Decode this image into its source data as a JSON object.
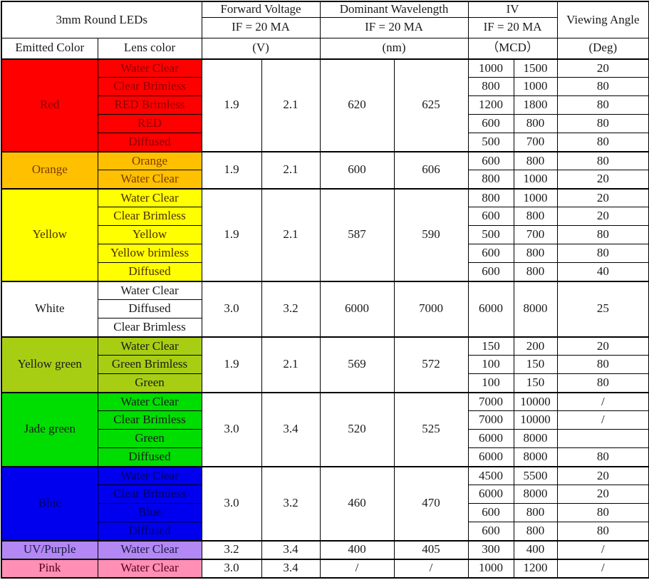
{
  "header": {
    "title": "3mm Round LEDs",
    "columns": [
      {
        "name": "Forward Voltage",
        "condition": "IF = 20 MA",
        "unit": "(V)"
      },
      {
        "name": "Dominant Wavelength",
        "condition": "IF = 20 MA",
        "unit": "(nm)"
      },
      {
        "name": "IV",
        "condition": "IF = 20 MA",
        "unit": "（MCD）"
      },
      {
        "name": "Viewing Angle",
        "condition": "",
        "unit": "(Deg)"
      }
    ],
    "emitted_color_label": "Emitted Color",
    "lens_color_label": "Lens color"
  },
  "groups": [
    {
      "emitted_color": "Red",
      "bg": "#FF0000",
      "text_color": "#8B0000",
      "lens_bg": "#FF0000",
      "lens_text": "#8B0000",
      "vf_min": "1.9",
      "vf_max": "2.1",
      "wl_min": "620",
      "wl_max": "625",
      "rows": [
        {
          "lens": "Water Clear",
          "iv_min": "1000",
          "iv_max": "1500",
          "angle": "20"
        },
        {
          "lens": "Clear Brimless",
          "iv_min": "800",
          "iv_max": "1000",
          "angle": "80"
        },
        {
          "lens": "RED Brimless",
          "iv_min": "1200",
          "iv_max": "1800",
          "angle": "80"
        },
        {
          "lens": "RED",
          "iv_min": "600",
          "iv_max": "800",
          "angle": "80"
        },
        {
          "lens": "Diffused",
          "iv_min": "500",
          "iv_max": "700",
          "angle": "80"
        }
      ]
    },
    {
      "emitted_color": "Orange",
      "bg": "#FFC000",
      "text_color": "#7A3B00",
      "lens_bg": "#FFC000",
      "lens_text": "#7A3B00",
      "vf_min": "1.9",
      "vf_max": "2.1",
      "wl_min": "600",
      "wl_max": "606",
      "rows": [
        {
          "lens": "Orange",
          "iv_min": "600",
          "iv_max": "800",
          "angle": "80"
        },
        {
          "lens": "Water Clear",
          "iv_min": "800",
          "iv_max": "1000",
          "angle": "20"
        }
      ]
    },
    {
      "emitted_color": "Yellow",
      "bg": "#FFFF00",
      "text_color": "#4A3000",
      "lens_bg": "#FFFF00",
      "lens_text": "#4A3000",
      "vf_min": "1.9",
      "vf_max": "2.1",
      "wl_min": "587",
      "wl_max": "590",
      "rows": [
        {
          "lens": "Water Clear",
          "iv_min": "800",
          "iv_max": "1000",
          "angle": "20"
        },
        {
          "lens": "Clear Brimless",
          "iv_min": "600",
          "iv_max": "800",
          "angle": "20"
        },
        {
          "lens": "Yellow",
          "iv_min": "500",
          "iv_max": "700",
          "angle": "80"
        },
        {
          "lens": "Yellow brimless",
          "iv_min": "600",
          "iv_max": "800",
          "angle": "80"
        },
        {
          "lens": "Diffused",
          "iv_min": "600",
          "iv_max": "800",
          "angle": "40"
        }
      ]
    },
    {
      "emitted_color": "White",
      "bg": "#FFFFFF",
      "text_color": "#1a1a1a",
      "lens_bg": "#FFFFFF",
      "lens_text": "#1a1a1a",
      "vf_min": "3.0",
      "vf_max": "3.2",
      "wl_min": "6000",
      "wl_max": "7000",
      "iv_merged": {
        "iv_min": "6000",
        "iv_max": "8000",
        "angle": "25"
      },
      "rows": [
        {
          "lens": "Water Clear"
        },
        {
          "lens": "Diffused"
        },
        {
          "lens": "Clear Brimless"
        }
      ]
    },
    {
      "emitted_color": "Yellow green",
      "bg": "#A8CE13",
      "text_color": "#1a1a1a",
      "lens_bg": "#A8CE13",
      "lens_text": "#1a1a1a",
      "vf_min": "1.9",
      "vf_max": "2.1",
      "wl_min": "569",
      "wl_max": "572",
      "rows": [
        {
          "lens": "Water Clear",
          "iv_min": "150",
          "iv_max": "200",
          "angle": "20"
        },
        {
          "lens": "Green Brimless",
          "iv_min": "100",
          "iv_max": "150",
          "angle": "80"
        },
        {
          "lens": "Green",
          "iv_min": "100",
          "iv_max": "150",
          "angle": "80"
        }
      ]
    },
    {
      "emitted_color": "Jade green",
      "bg": "#00DD00",
      "text_color": "#1a1a1a",
      "lens_bg": "#00DD00",
      "lens_text": "#1a1a1a",
      "vf_min": "3.0",
      "vf_max": "3.4",
      "wl_min": "520",
      "wl_max": "525",
      "rows": [
        {
          "lens": "Water Clear",
          "iv_min": "7000",
          "iv_max": "10000",
          "angle": "/"
        },
        {
          "lens": "Clear Brimless",
          "iv_min": "7000",
          "iv_max": "10000",
          "angle": "/"
        },
        {
          "lens": "Green",
          "iv_min": "6000",
          "iv_max": "8000",
          "angle": ""
        },
        {
          "lens": "Diffused",
          "iv_min": "6000",
          "iv_max": "8000",
          "angle": "80"
        }
      ]
    },
    {
      "emitted_color": "Blue",
      "bg": "#0000EE",
      "text_color": "#000060",
      "lens_bg": "#0000EE",
      "lens_text": "#000060",
      "vf_min": "3.0",
      "vf_max": "3.2",
      "wl_min": "460",
      "wl_max": "470",
      "rows": [
        {
          "lens": "Water Clear",
          "iv_min": "4500",
          "iv_max": "5500",
          "angle": "20"
        },
        {
          "lens": "Clear Brimless",
          "iv_min": "6000",
          "iv_max": "8000",
          "angle": "20"
        },
        {
          "lens": "Blue",
          "iv_min": "600",
          "iv_max": "800",
          "angle": "80"
        },
        {
          "lens": "Diffused",
          "iv_min": "600",
          "iv_max": "800",
          "angle": "80"
        }
      ]
    },
    {
      "emitted_color": "UV/Purple",
      "bg": "#B388F5",
      "text_color": "#1a1a40",
      "lens_bg": "#B388F5",
      "lens_text": "#1a1a40",
      "vf_min": "3.2",
      "vf_max": "3.4",
      "wl_min": "400",
      "wl_max": "405",
      "rows": [
        {
          "lens": "Water Clear",
          "iv_min": "300",
          "iv_max": "400",
          "angle": "/"
        }
      ]
    },
    {
      "emitted_color": "Pink",
      "bg": "#FF8FB4",
      "text_color": "#5a0020",
      "lens_bg": "#FF8FB4",
      "lens_text": "#5a0020",
      "vf_min": "3.0",
      "vf_max": "3.4",
      "wl_min": "/",
      "wl_max": "/",
      "rows": [
        {
          "lens": "Water Clear",
          "iv_min": "1000",
          "iv_max": "1200",
          "angle": "/"
        }
      ]
    }
  ]
}
